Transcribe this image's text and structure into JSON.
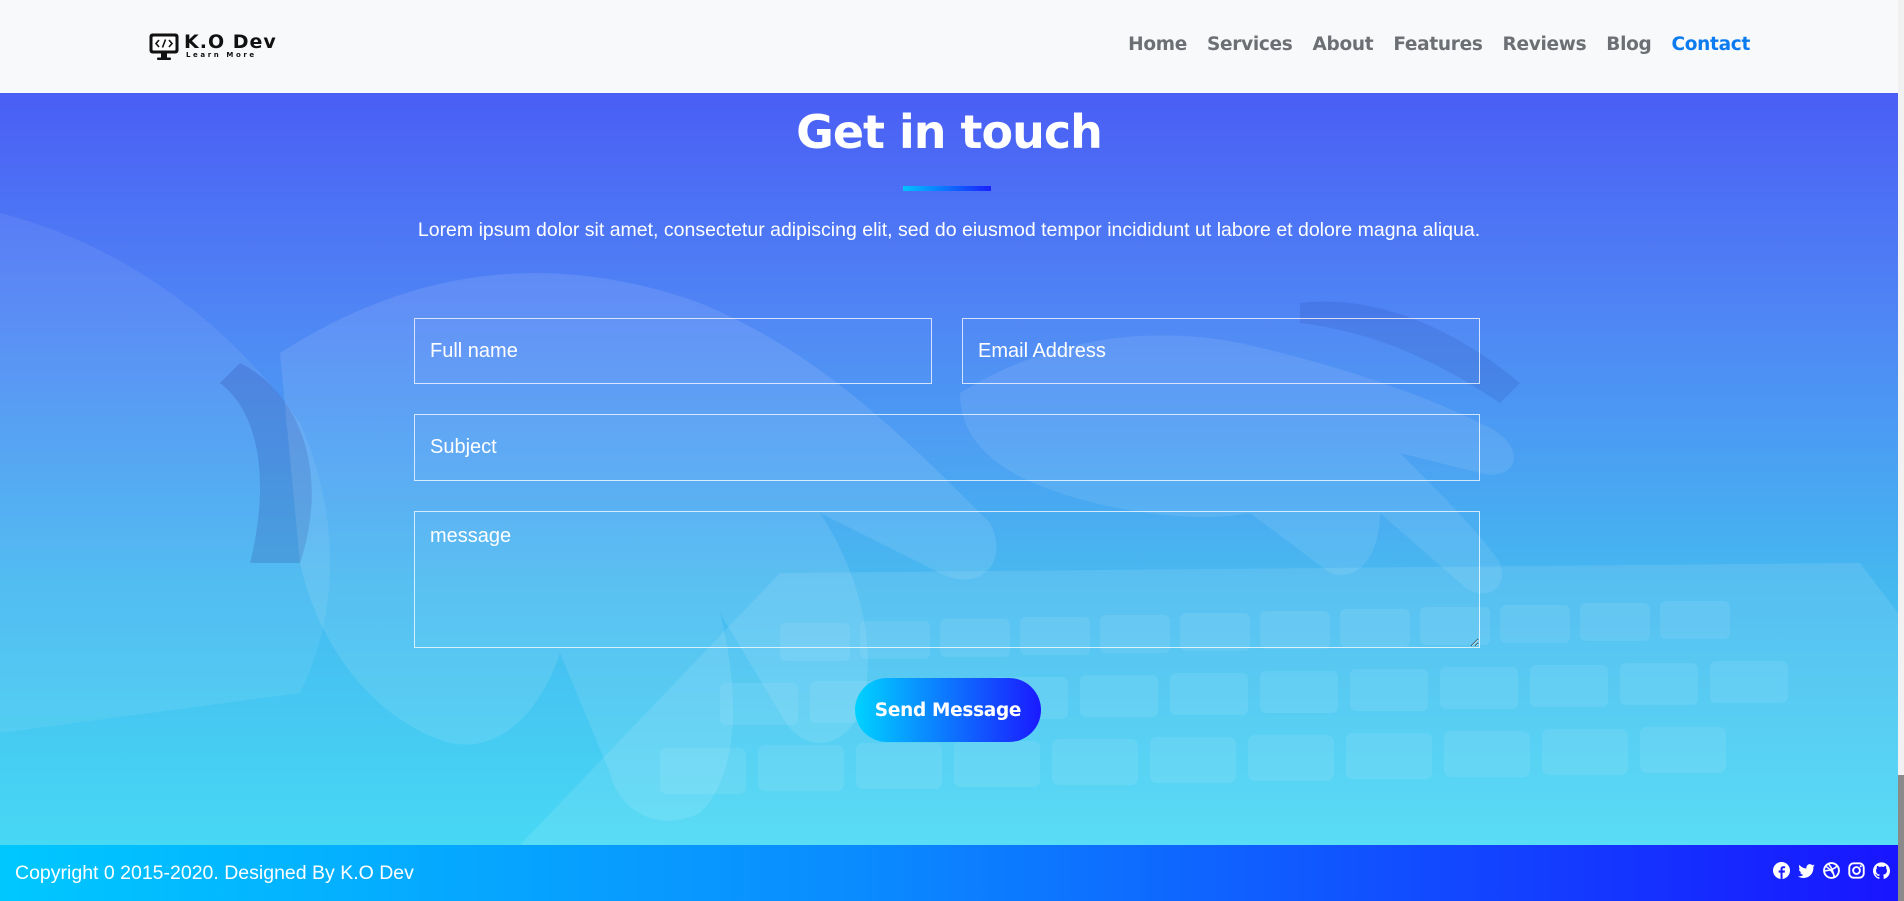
{
  "brand": {
    "name": "K.O Dev",
    "tagline": "Learn More"
  },
  "nav": {
    "items": [
      {
        "label": "Home",
        "active": false
      },
      {
        "label": "Services",
        "active": false
      },
      {
        "label": "About",
        "active": false
      },
      {
        "label": "Features",
        "active": false
      },
      {
        "label": "Reviews",
        "active": false
      },
      {
        "label": "Blog",
        "active": false
      },
      {
        "label": "Contact",
        "active": true
      }
    ],
    "active_color": "#0d7bf0"
  },
  "contact": {
    "title": "Get in touch",
    "lead": "Lorem ipsum dolor sit amet, consectetur adipiscing elit, sed do eiusmod tempor incididunt ut labore et dolore magna aliqua.",
    "fullname_placeholder": "Full name",
    "email_placeholder": "Email Address",
    "subject_placeholder": "Subject",
    "message_placeholder": "message",
    "send_label": "Send Message"
  },
  "footer": {
    "copyright": "Copyright 0 2015-2020. Designed By K.O Dev",
    "social": [
      "facebook-icon",
      "twitter-icon",
      "dribbble-icon",
      "instagram-icon",
      "github-icon"
    ]
  },
  "colors": {
    "gradient_start": "#00c8ff",
    "gradient_end": "#1815ff",
    "hero_top": "#4a5ef5",
    "hero_bottom": "#47d8f4"
  }
}
